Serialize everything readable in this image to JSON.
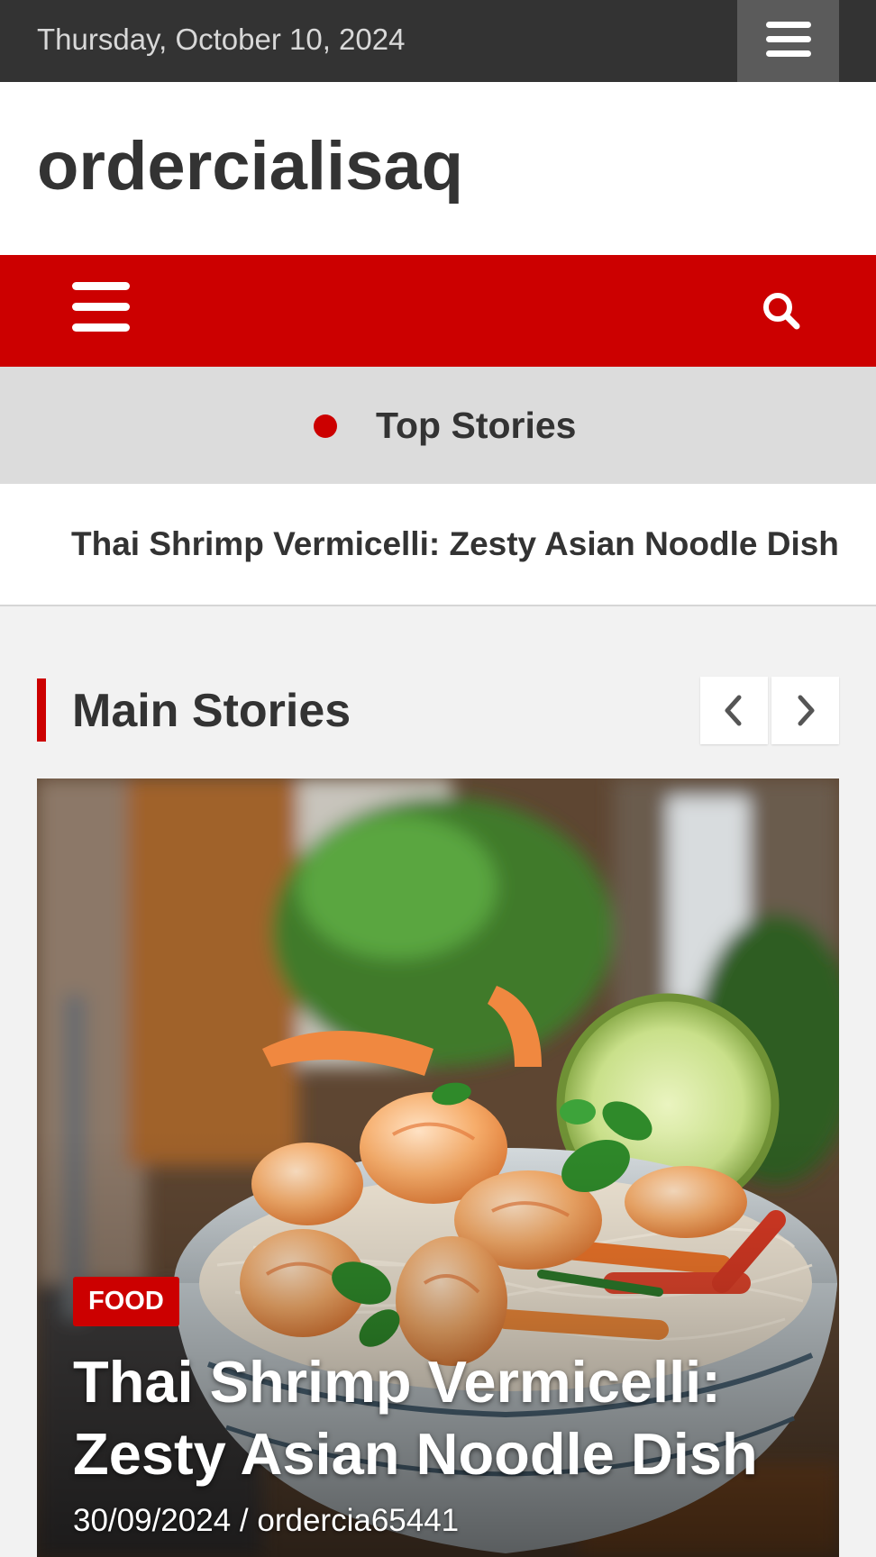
{
  "topbar": {
    "date": "Thursday, October 10, 2024",
    "menu_icon": "hamburger-icon"
  },
  "header": {
    "site_title": "ordercialisaq"
  },
  "nav": {
    "menu_icon": "hamburger-icon",
    "search_icon": "search-icon"
  },
  "ticker": {
    "title": "Top Stories",
    "items": [
      "Thai Shrimp Vermicelli: Zesty Asian Noodle Dish"
    ]
  },
  "main": {
    "section_title": "Main Stories",
    "prev_icon": "chevron-left-icon",
    "next_icon": "chevron-right-icon",
    "featured": {
      "category": "FOOD",
      "title": "Thai Shrimp Vermicelli: Zesty Asian Noodle Dish",
      "date": "30/09/2024",
      "separator": "/",
      "author": "ordercia65441"
    }
  },
  "colors": {
    "accent": "#cc0000",
    "topbar": "#333333",
    "ticker_bg": "#dcdcdc",
    "page_bg": "#f2f2f2"
  }
}
